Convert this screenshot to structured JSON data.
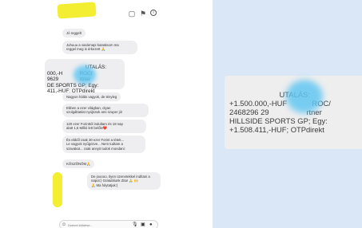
{
  "chat": {
    "header_icons": [
      "video-icon",
      "flag-icon",
      "info-icon"
    ],
    "messages": [
      {
        "dir": "in",
        "text": "Jó reggelt"
      },
      {
        "dir": "in",
        "text": "Juhuuu a vasárnapi kutatásom ma\nreggel meg is érkezett 🙏"
      },
      {
        "dir": "in",
        "text": "                           UTALÁS:\n000,-H            ROC/\n9629               rtner\nDE SPORTS GP; Egy:\n411,-HUF; OTPdirekt"
      },
      {
        "dir": "in",
        "text": "Nagyon hálás vagyok, de tényleg"
      },
      {
        "dir": "in",
        "text": "Ebben a ezer világban, olyan\nszolgáltatást nyújtotok ami szuper jó!"
      },
      {
        "dir": "in",
        "text": "120 ezer Forinttól indultam és 18 nap\nalatt 1,5 Millió lett belőle❤️"
      },
      {
        "dir": "in",
        "text": "És ebből csak 30 ezer Forint a tétek...\nLe vagyok nyűgözve... Nem tudtam a\nszavakat... csak annyit tudok mondani:"
      },
      {
        "dir": "in",
        "text": "KÖSZÖNÖM🙏"
      },
      {
        "dir": "out",
        "text": "De jooooo, Ilyen üzenetekkel indítani a\nnapot:) Gratulálunk Zita! 🙏 🙌\n🙏 Ma folytatjuk:)"
      }
    ],
    "composer_placeholder": "Üzenet küldése..."
  },
  "zoom": {
    "lines": [
      "                        UTALÁS:",
      "+1.500.000,-HUF            ROC/",
      "2468296 29                  rtner",
      "HILLSIDE SPORTS GP; Egy:",
      "+1.508.411,-HUF; OTPdirekt"
    ]
  }
}
